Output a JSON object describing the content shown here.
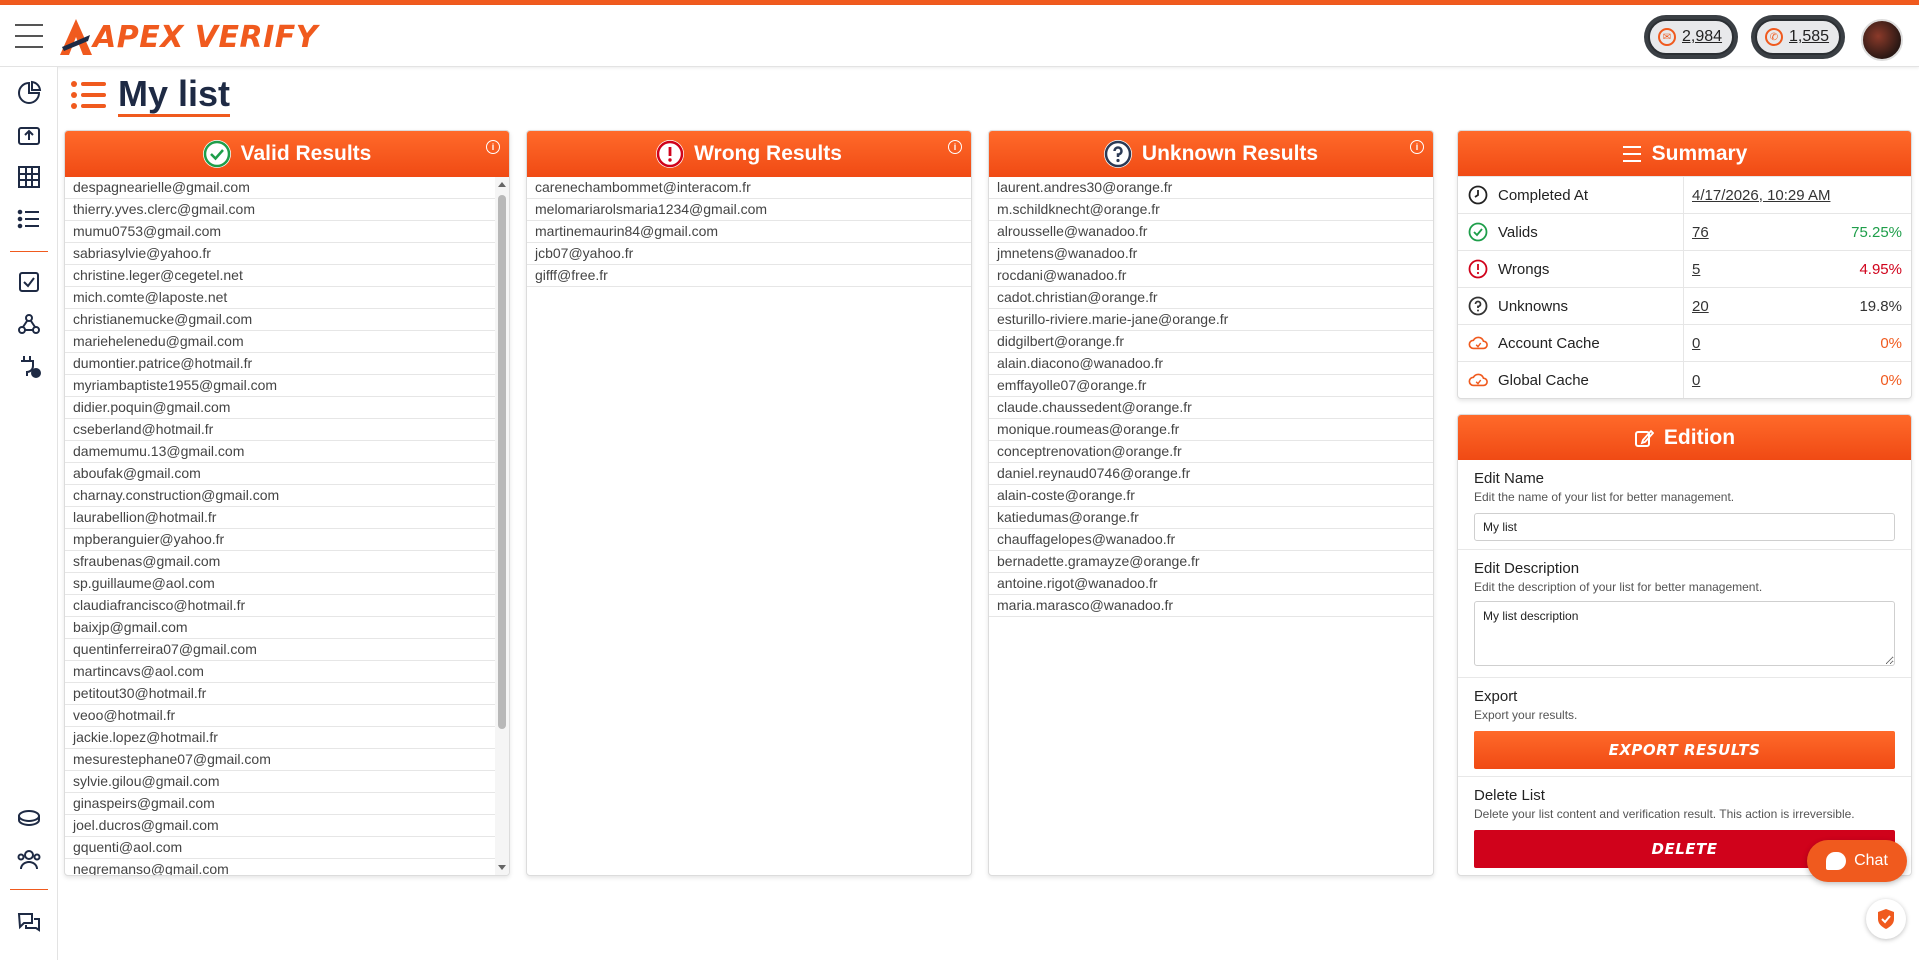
{
  "app": {
    "logo_text": "APEX VERIFY"
  },
  "header": {
    "credits_email": "2,984",
    "credits_phone": "1,585"
  },
  "page": {
    "title": "My list"
  },
  "panels": {
    "valid": {
      "title": "Valid Results",
      "emails": [
        "despagnearielle@gmail.com",
        "thierry.yves.clerc@gmail.com",
        "mumu0753@gmail.com",
        "sabriasylvie@yahoo.fr",
        "christine.leger@cegetel.net",
        "mich.comte@laposte.net",
        "christianemucke@gmail.com",
        "mariehelenedu@gmail.com",
        "dumontier.patrice@hotmail.fr",
        "myriambaptiste1955@gmail.com",
        "didier.poquin@gmail.com",
        "cseberland@hotmail.fr",
        "damemumu.13@gmail.com",
        "aboufak@gmail.com",
        "charnay.construction@gmail.com",
        "laurabellion@hotmail.fr",
        "mpberanguier@yahoo.fr",
        "sfraubenas@gmail.com",
        "sp.guillaume@aol.com",
        "claudiafrancisco@hotmail.fr",
        "baixjp@gmail.com",
        "quentinferreira07@gmail.com",
        "martincavs@aol.com",
        "petitout30@hotmail.fr",
        "veoo@hotmail.fr",
        "jackie.lopez@hotmail.fr",
        "mesurestephane07@gmail.com",
        "sylvie.gilou@gmail.com",
        "ginaspeirs@gmail.com",
        "joel.ducros@gmail.com",
        "gquenti@aol.com",
        "negremanso@gmail.com"
      ]
    },
    "wrong": {
      "title": "Wrong Results",
      "emails": [
        "carenechambommet@interacom.fr",
        "melomariarolsmaria1234@gmail.com",
        "martinemaurin84@gmail.com",
        "jcb07@yahoo.fr",
        "gifff@free.fr"
      ]
    },
    "unknown": {
      "title": "Unknown Results",
      "emails": [
        "laurent.andres30@orange.fr",
        "m.schildknecht@orange.fr",
        "alrousselle@wanadoo.fr",
        "jmnetens@wanadoo.fr",
        "rocdani@wanadoo.fr",
        "cadot.christian@orange.fr",
        "esturillo-riviere.marie-jane@orange.fr",
        "didgilbert@orange.fr",
        "alain.diacono@wanadoo.fr",
        "emffayolle07@orange.fr",
        "claude.chaussedent@orange.fr",
        "monique.roumeas@orange.fr",
        "conceptrenovation@orange.fr",
        "daniel.reynaud0746@orange.fr",
        "alain-coste@orange.fr",
        "katiedumas@orange.fr",
        "chauffagelopes@wanadoo.fr",
        "bernadette.gramayze@orange.fr",
        "antoine.rigot@wanadoo.fr",
        "maria.marasco@wanadoo.fr"
      ]
    }
  },
  "summary": {
    "title": "Summary",
    "rows": [
      {
        "label": "Completed At",
        "value": "4/17/2026, 10:29 AM",
        "pct": "",
        "pct_color": "#222222",
        "icon": "clock-icon"
      },
      {
        "label": "Valids",
        "value": "76",
        "pct": "75.25%",
        "pct_color": "#1e9e4a",
        "icon": "check-circle-icon"
      },
      {
        "label": "Wrongs",
        "value": "5",
        "pct": "4.95%",
        "pct_color": "#d0021b",
        "icon": "alert-circle-icon"
      },
      {
        "label": "Unknowns",
        "value": "20",
        "pct": "19.8%",
        "pct_color": "#333333",
        "icon": "question-circle-icon"
      },
      {
        "label": "Account Cache",
        "value": "0",
        "pct": "0%",
        "pct_color": "#f05a1e",
        "icon": "cloud-icon"
      },
      {
        "label": "Global Cache",
        "value": "0",
        "pct": "0%",
        "pct_color": "#f05a1e",
        "icon": "cloud-icon"
      }
    ]
  },
  "edition": {
    "title": "Edition",
    "name_label": "Edit Name",
    "name_help": "Edit the name of your list for better management.",
    "name_value": "My list",
    "desc_label": "Edit Description",
    "desc_help": "Edit the description of your list for better management.",
    "desc_value": "My list description",
    "export_label": "Export",
    "export_help": "Export your results.",
    "export_button": "EXPORT RESULTS",
    "delete_label": "Delete List",
    "delete_help": "Delete your list content and verification result. This action is irreversible.",
    "delete_button": "DELETE"
  },
  "chat": {
    "label": "Chat"
  },
  "colors": {
    "accent": "#f05a1e",
    "valid": "#1e9e4a",
    "wrong": "#d0021b",
    "unknown": "#2b3a55"
  }
}
